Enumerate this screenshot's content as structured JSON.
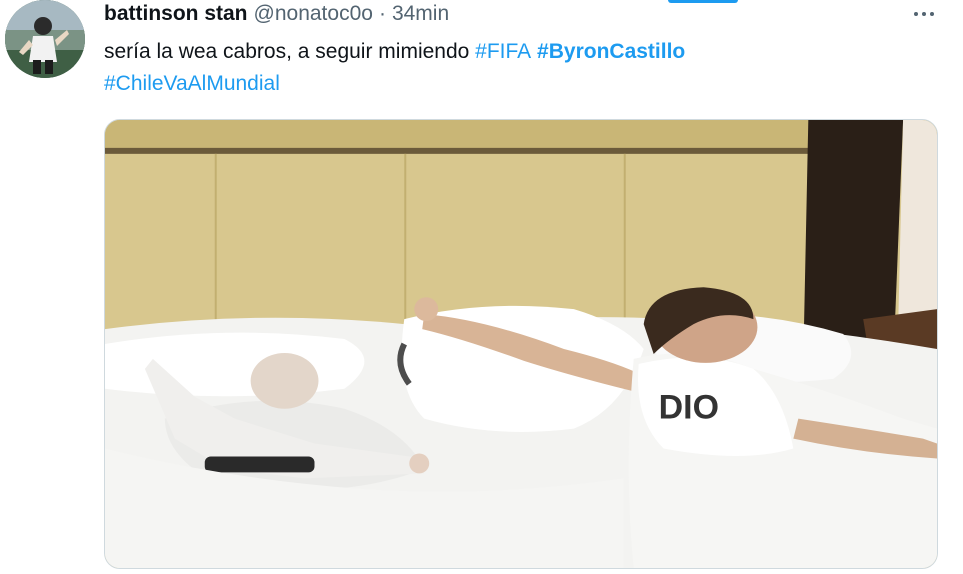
{
  "tweet": {
    "display_name": "battinson stan",
    "handle": "@nonatoc0o",
    "separator": "·",
    "time": "34min",
    "text_plain": "sería la wea cabros, a seguir mimiendo ",
    "hashtags": [
      "#FIFA",
      "#ByronCastillo",
      "#ChileVaAlMundial"
    ],
    "shirt_text": "DIO"
  },
  "colors": {
    "link": "#1d9bf0",
    "secondary_text": "#536471",
    "primary_text": "#0f1419"
  },
  "icons": {
    "more": "more-horizontal-icon"
  }
}
